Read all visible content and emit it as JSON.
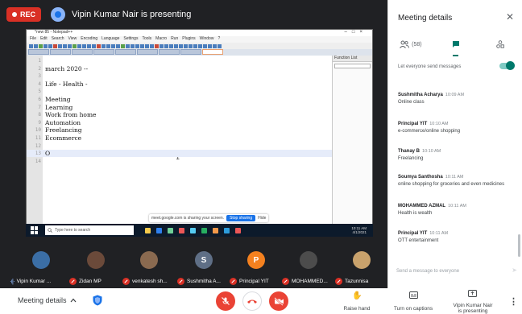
{
  "recording": {
    "label": "REC"
  },
  "presenter_banner": "Vipin Kumar Nair is presenting",
  "notepad": {
    "title": "*new 85 - Notepad++",
    "menu": [
      "File",
      "Edit",
      "Search",
      "View",
      "Encoding",
      "Language",
      "Settings",
      "Tools",
      "Macro",
      "Run",
      "Plugins",
      "Window",
      "?"
    ],
    "lines": [
      {
        "n": "1",
        "t": ""
      },
      {
        "n": "2",
        "t": "march 2020 --"
      },
      {
        "n": "3",
        "t": ""
      },
      {
        "n": "4",
        "t": "Life - Health -"
      },
      {
        "n": "5",
        "t": ""
      },
      {
        "n": "6",
        "t": "Meeting"
      },
      {
        "n": "7",
        "t": "Learning"
      },
      {
        "n": "8",
        "t": "Work from home"
      },
      {
        "n": "9",
        "t": "Automation"
      },
      {
        "n": "10",
        "t": "Freelancing"
      },
      {
        "n": "11",
        "t": "Ecommerce"
      },
      {
        "n": "12",
        "t": ""
      },
      {
        "n": "13",
        "t": "O"
      },
      {
        "n": "14",
        "t": ""
      }
    ],
    "function_list_title": "Function List",
    "status_left": "Normal text file",
    "status_mid": "length : 138   lines : 14",
    "status_right": "Ln : 13   Col : 2   Pos : 128",
    "status_enc": "Windows (CR LF)   UTF-8   INS"
  },
  "share_banner": {
    "text": "meet.google.com is sharing your screen.",
    "stop": "Stop sharing",
    "hide": "Hide"
  },
  "taskbar": {
    "search_placeholder": "Type here to search",
    "time": "10:11 AM",
    "date": "4/1/2021"
  },
  "participants": [
    {
      "name": "Vipin Kumar ...",
      "initial": "",
      "color": "#3b6ea5",
      "speaking": true
    },
    {
      "name": "Zidan MP",
      "initial": "",
      "color": "#6b4a3a",
      "speaking": false
    },
    {
      "name": "venkatesh sh...",
      "initial": "",
      "color": "#8a6a50",
      "speaking": false
    },
    {
      "name": "Sushmitha A...",
      "initial": "S",
      "color": "#5f6f86",
      "speaking": false
    },
    {
      "name": "Principal YIT",
      "initial": "P",
      "color": "#f4811f",
      "speaking": false
    },
    {
      "name": "MOHAMMED...",
      "initial": "",
      "color": "#4c4c4c",
      "speaking": false
    },
    {
      "name": "Tazunnisa",
      "initial": "",
      "color": "#c9a26c",
      "speaking": false
    }
  ],
  "bottom_bar": {
    "meeting_details": "Meeting details",
    "raise_hand": "Raise hand",
    "captions": "Turn on captions",
    "presenting_line1": "Vipin Kumar Nair",
    "presenting_line2": "is presenting"
  },
  "panel": {
    "title": "Meeting details",
    "people_count": "(58)",
    "let_everyone": "Let everyone send messages",
    "messages": [
      {
        "who": "Sushmitha Acharya",
        "when": "10:09 AM",
        "body": "Online class"
      },
      {
        "who": "Principal YIT",
        "when": "10:10 AM",
        "body": "e-commerce/online shopping"
      },
      {
        "who": "Thanay B",
        "when": "10:10 AM",
        "body": "Freelancing"
      },
      {
        "who": "Soumya Santhosha",
        "when": "10:11 AM",
        "body": "online shopping for groceries and even medicines"
      },
      {
        "who": "MOHAMMED AZMAL",
        "when": "10:11 AM",
        "body": "Health is wealth"
      },
      {
        "who": "Principal YIT",
        "when": "10:11 AM",
        "body": "OTT entertainment"
      }
    ],
    "input_placeholder": "Send a message to everyone"
  }
}
